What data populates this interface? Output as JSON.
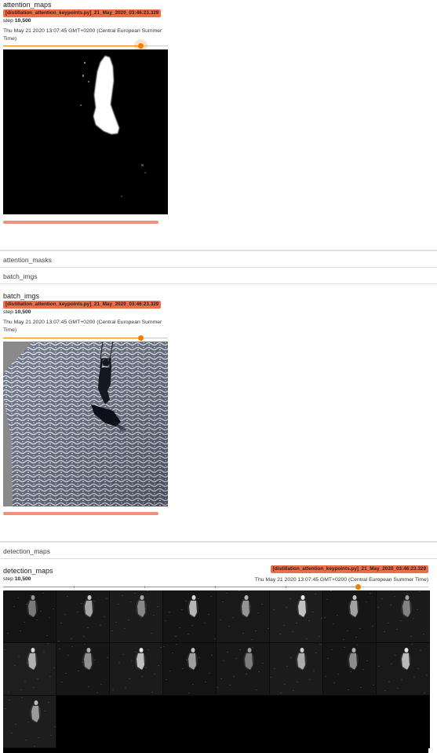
{
  "cards": [
    {
      "title": "attention_maps",
      "run": "[distillation_attention_keypoints.py]_21_May_2020_03:46:23.329",
      "step_label": "step",
      "step_value": "10,500",
      "timestamp": "Thu May 21 2020 13:07:45 GMT+0200 (Central European Summer Time)"
    },
    {
      "title": "batch_imgs",
      "run": "[distillation_attention_keypoints.py]_21_May_2020_03:46:23.329",
      "step_label": "step",
      "step_value": "10,500",
      "timestamp": "Thu May 21 2020 13:07:45 GMT+0200 (Central European Summer Time)"
    },
    {
      "title": "detection_maps",
      "run": "[distillation_attention_keypoints.py]_21_May_2020_03:46:23.329",
      "step_label": "step",
      "step_value": "10,500",
      "timestamp": "Thu May 21 2020 13:07:45 GMT+0200 (Central European Summer Time)"
    }
  ],
  "sections": {
    "attention_masks": "attention_masks",
    "batch_imgs": "batch_imgs",
    "detection_maps": "detection_maps"
  },
  "colors": {
    "run_tag": "#ef6e4a",
    "slider": "#f57c00",
    "pin_bar": "#f1917a"
  },
  "detection_grid": {
    "columns": 8,
    "tiles_shown": 17
  }
}
